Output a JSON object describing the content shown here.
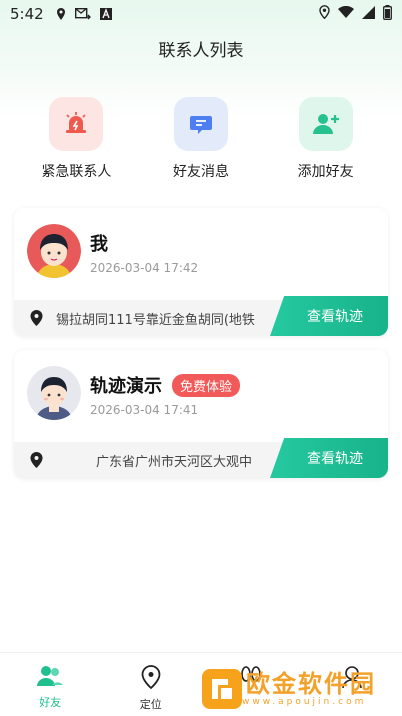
{
  "status_bar": {
    "time": "5:42"
  },
  "header": {
    "title": "联系人列表"
  },
  "quick_actions": [
    {
      "label": "紧急联系人",
      "icon": "alarm-icon"
    },
    {
      "label": "好友消息",
      "icon": "message-icon"
    },
    {
      "label": "添加好友",
      "icon": "add-user-icon"
    }
  ],
  "contacts": [
    {
      "name": "我",
      "time": "2026-03-04 17:42",
      "address": "锡拉胡同111号靠近金鱼胡同(地铁",
      "track_label": "查看轨迹"
    },
    {
      "name": "轨迹演示",
      "badge": "免费体验",
      "time": "2026-03-04 17:41",
      "address": "广东省广州市天河区大观中",
      "track_label": "查看轨迹"
    }
  ],
  "tabbar": [
    {
      "label": "好友",
      "active": true,
      "icon": "friends-icon"
    },
    {
      "label": "定位",
      "active": false,
      "icon": "location-icon"
    },
    {
      "label": "",
      "active": false,
      "icon": "footprint-icon"
    },
    {
      "label": "",
      "active": false,
      "icon": "profile-icon"
    }
  ],
  "watermark": {
    "text": "欧金软件园",
    "url": "www.apoujin.com"
  },
  "colors": {
    "accent": "#1fbf8f",
    "badge": "#f25a5a",
    "alarm": "#ef5a4f",
    "message": "#4e7ff0",
    "add": "#27c08f"
  }
}
